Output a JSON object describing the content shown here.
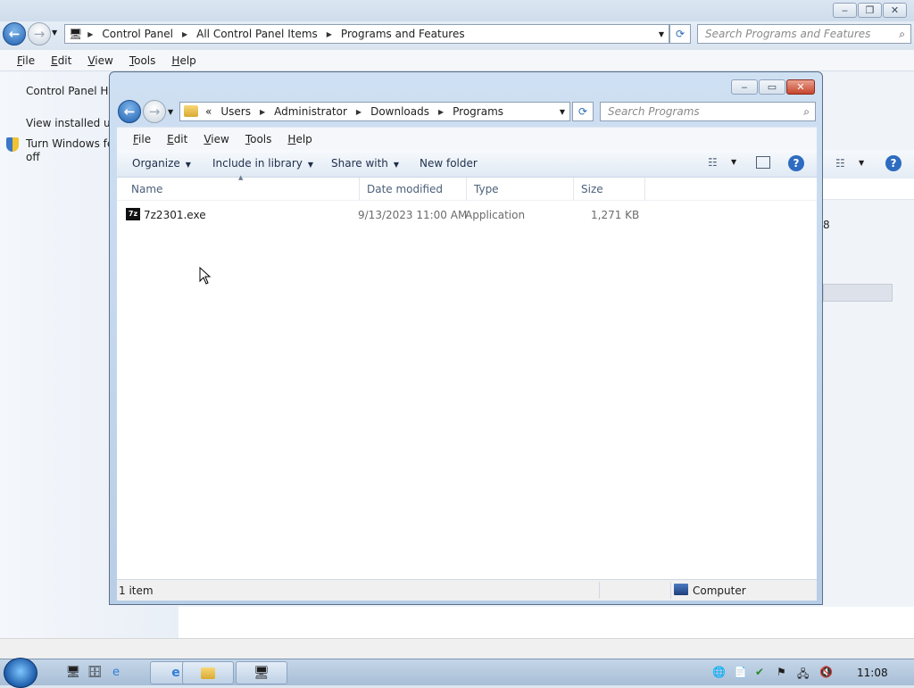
{
  "back_window": {
    "breadcrumb": [
      "Control Panel",
      "All Control Panel Items",
      "Programs and Features"
    ],
    "search_placeholder": "Search Programs and Features",
    "menu": [
      "File",
      "Edit",
      "View",
      "Tools",
      "Help"
    ],
    "left_links": [
      "Control Panel Ho",
      "View installed upc",
      "Turn Windows fea",
      "off"
    ],
    "partial_text": "8"
  },
  "front_window": {
    "breadcrumb": [
      "Users",
      "Administrator",
      "Downloads",
      "Programs"
    ],
    "breadcrumb_overflow": "«",
    "search_placeholder": "Search Programs",
    "menu": [
      "File",
      "Edit",
      "View",
      "Tools",
      "Help"
    ],
    "toolbar": {
      "organize": "Organize",
      "include_in_library": "Include in library",
      "share_with": "Share with",
      "new_folder": "New folder"
    },
    "columns": [
      "Name",
      "Date modified",
      "Type",
      "Size"
    ],
    "files": [
      {
        "name": "7z2301.exe",
        "date_modified": "9/13/2023 11:00 AM",
        "type": "Application",
        "size": "1,271 KB",
        "icon": "7z"
      }
    ],
    "status": {
      "count": "1 item",
      "location": "Computer"
    }
  },
  "taskbar": {
    "clock": "11:08"
  }
}
